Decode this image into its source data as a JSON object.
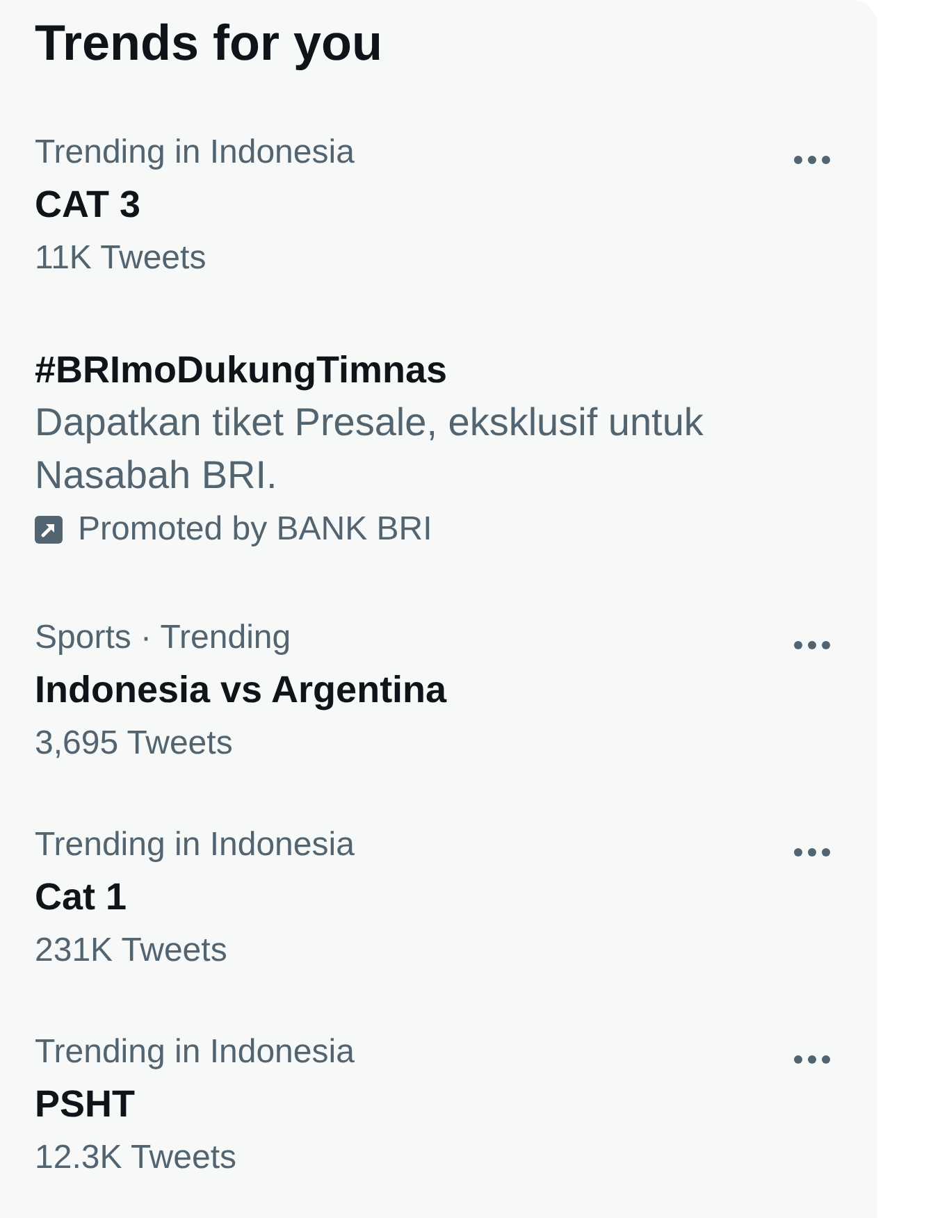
{
  "panel": {
    "title": "Trends for you"
  },
  "trends": [
    {
      "kind": "trend",
      "context": "Trending in Indonesia",
      "name": "CAT 3",
      "count": "11K Tweets"
    },
    {
      "kind": "promoted",
      "name": "#BRImoDukungTimnas",
      "description": "Dapatkan tiket Presale, eksklusif untuk Nasabah BRI.",
      "promoter": "Promoted by BANK BRI"
    },
    {
      "kind": "trend",
      "context": "Sports · Trending",
      "name": "Indonesia vs Argentina",
      "count": "3,695 Tweets"
    },
    {
      "kind": "trend",
      "context": "Trending in Indonesia",
      "name": "Cat 1",
      "count": "231K Tweets"
    },
    {
      "kind": "trend",
      "context": "Trending in Indonesia",
      "name": "PSHT",
      "count": "12.3K Tweets"
    }
  ]
}
